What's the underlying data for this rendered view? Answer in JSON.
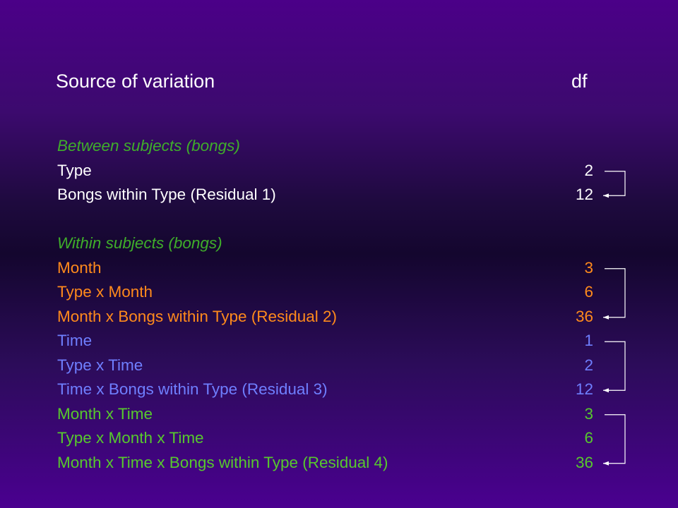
{
  "header": {
    "source": "Source of variation",
    "df": "df"
  },
  "colors": {
    "white": "#ffffff",
    "section": "#3fae2a",
    "orange": "#ff8a1c",
    "blue": "#6f7fff",
    "green": "#57c92d"
  },
  "rows": [
    {
      "label": "Between subjects (bongs)",
      "df": "",
      "kind": "section",
      "color": "#3fae2a"
    },
    {
      "label": "Type",
      "df": "2",
      "kind": "term",
      "color": "#ffffff"
    },
    {
      "label": "Bongs within Type (Residual 1)",
      "df": "12",
      "kind": "residual",
      "color": "#ffffff"
    },
    {
      "label": "",
      "df": "",
      "kind": "spacer",
      "color": "#ffffff"
    },
    {
      "label": "Within subjects (bongs)",
      "df": "",
      "kind": "section",
      "color": "#3fae2a"
    },
    {
      "label": "Month",
      "df": "3",
      "kind": "term",
      "color": "#ff8a1c"
    },
    {
      "label": "Type x Month",
      "df": "6",
      "kind": "term",
      "color": "#ff8a1c"
    },
    {
      "label": "Month x Bongs within Type (Residual 2)",
      "df": "36",
      "kind": "residual",
      "color": "#ff8a1c"
    },
    {
      "label": "Time",
      "df": "1",
      "kind": "term",
      "color": "#6f7fff"
    },
    {
      "label": "Type x Time",
      "df": "2",
      "kind": "term",
      "color": "#6f7fff"
    },
    {
      "label": "Time x Bongs within Type (Residual 3)",
      "df": "12",
      "kind": "residual",
      "color": "#6f7fff"
    },
    {
      "label": "Month x Time",
      "df": "3",
      "kind": "term",
      "color": "#57c92d"
    },
    {
      "label": "Type x Month x Time",
      "df": "6",
      "kind": "term",
      "color": "#57c92d"
    },
    {
      "label": "Month x Time x Bongs within Type (Residual 4)",
      "df": "36",
      "kind": "residual",
      "color": "#57c92d"
    }
  ],
  "error_term_groups": [
    {
      "from_rows": [
        1
      ],
      "to_row": 2
    },
    {
      "from_rows": [
        5,
        6
      ],
      "to_row": 7
    },
    {
      "from_rows": [
        8,
        9
      ],
      "to_row": 10
    },
    {
      "from_rows": [
        11,
        12
      ],
      "to_row": 13
    }
  ]
}
